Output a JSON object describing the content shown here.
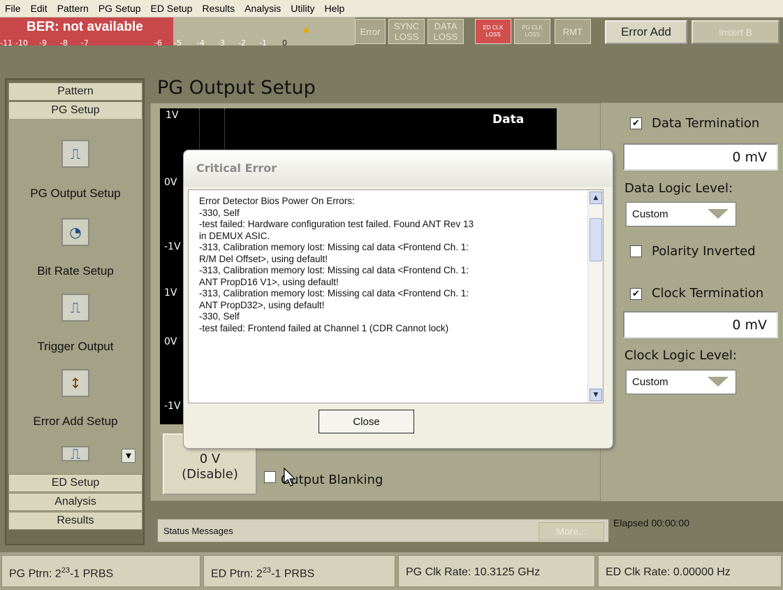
{
  "menu": [
    "File",
    "Edit",
    "Pattern",
    "PG Setup",
    "ED Setup",
    "Results",
    "Analysis",
    "Utility",
    "Help"
  ],
  "ber": {
    "text": "BER: not available",
    "scale": [
      "-11",
      "-10",
      "-9",
      "-8",
      "-7",
      "-6",
      "-5",
      "-4",
      "-3",
      "-2",
      "-1",
      "0"
    ]
  },
  "status_indicators": {
    "error": "Error",
    "sync1": "SYNC",
    "sync2": "LOSS",
    "data1": "DATA",
    "data2": "LOSS",
    "edclk1": "ED CLK",
    "edclk2": "LOSS",
    "pgclk1": "PG CLK",
    "pgclk2": "LOSS",
    "rmt": "RMT"
  },
  "toolbar": {
    "error_add": "Error Add",
    "insert": "Insert B"
  },
  "sidebar": {
    "pattern": "Pattern",
    "pg_setup": "PG Setup",
    "items": [
      {
        "label": "PG Output Setup",
        "icon": "pg-output-icon"
      },
      {
        "label": "Bit Rate Setup",
        "icon": "gauge-icon"
      },
      {
        "label": "Trigger Output",
        "icon": "pulse-icon"
      },
      {
        "label": "Error Add Setup",
        "icon": "error-insert-icon"
      }
    ],
    "ed_setup": "ED Setup",
    "analysis": "Analysis",
    "results": "Results"
  },
  "page": {
    "title": "PG Output Setup"
  },
  "scope": {
    "data": "Data",
    "labels": [
      "1V",
      "0V",
      "-1V",
      "1V",
      "0V",
      "-1V"
    ]
  },
  "right": {
    "data_term": "Data Termination",
    "data_mv": "0 mV",
    "data_logic_label": "Data Logic Level:",
    "data_logic_value": "Custom",
    "polarity": "Polarity Inverted",
    "clock_term": "Clock Termination",
    "clock_mv": "0 mV",
    "clock_logic_label": "Clock Logic Level:",
    "clock_logic_value": "Custom"
  },
  "controls": {
    "disable_line1": "0 V",
    "disable_line2": "(Disable)",
    "output_blanking": "Output Blanking"
  },
  "status": {
    "label": "Status Messages",
    "more": "More...",
    "elapsed": "Elapsed 00:00:00"
  },
  "bottom": {
    "pg_ptrn_a": "PG Ptrn: 2",
    "pg_ptrn_sup": "23",
    "pg_ptrn_b": "-1 PRBS",
    "ed_ptrn_a": "ED Ptrn: 2",
    "ed_ptrn_sup": "23",
    "ed_ptrn_b": "-1 PRBS",
    "pg_clk": "PG Clk Rate: 10.3125 GHz",
    "ed_clk": "ED Clk Rate: 0.00000 Hz"
  },
  "dialog": {
    "title": "Critical Error",
    "lines": [
      "Error Detector Bios Power On Errors:",
      "-330, Self",
      "-test failed: Hardware configuration test failed. Found ANT Rev 13",
      "in DEMUX ASIC.",
      "-313, Calibration memory lost: Missing cal data <Frontend Ch. 1:",
      "R/M Del Offset>, using default!",
      "-313, Calibration memory lost: Missing cal data <Frontend Ch. 1:",
      "ANT PropD16 V1>, using default!",
      "-313, Calibration memory lost: Missing cal data <Frontend Ch. 1:",
      "ANT PropD32>, using default!",
      "-330, Self",
      "-test failed: Frontend failed at Channel 1 (CDR Cannot lock)"
    ],
    "close": "Close"
  }
}
